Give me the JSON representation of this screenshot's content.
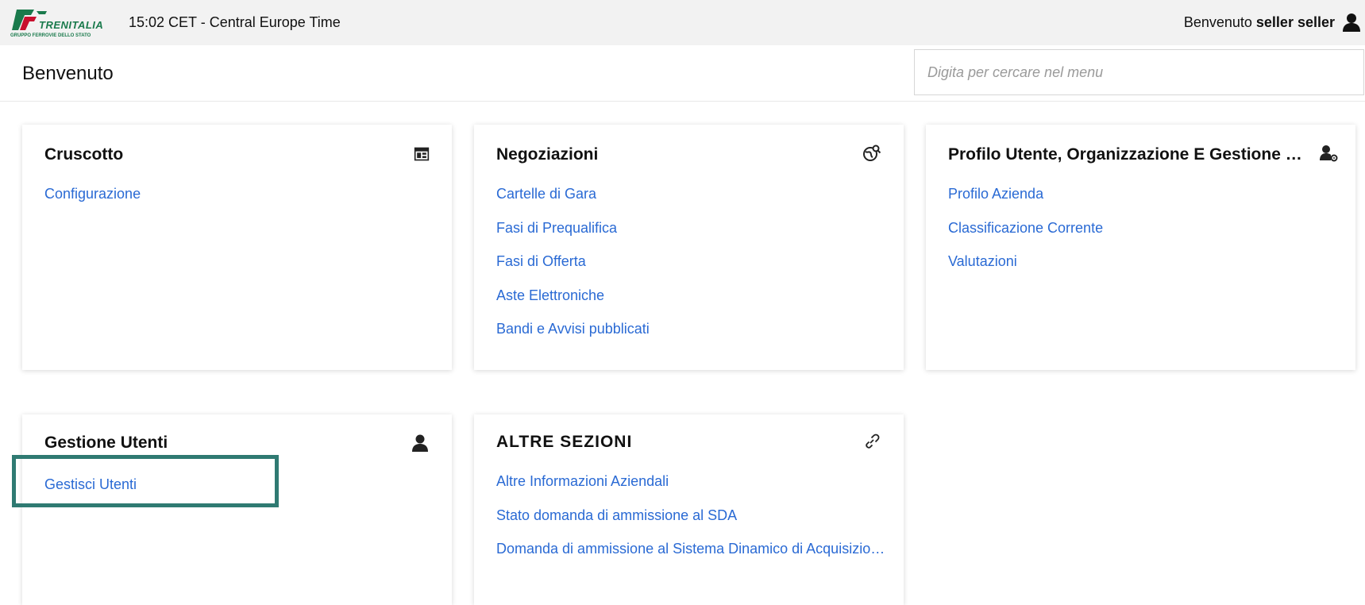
{
  "header": {
    "logo_text": "TRENITALIA",
    "logo_subtext": "GRUPPO FERROVIE DELLO STATO",
    "clock": "15:02 CET - Central Europe Time",
    "welcome_label": "Benvenuto",
    "user_name": "seller seller"
  },
  "subheader": {
    "title": "Benvenuto",
    "search_placeholder": "Digita per cercare nel menu"
  },
  "cards": [
    {
      "title": "Cruscotto",
      "icon": "dashboard-icon",
      "links": [
        "Configurazione"
      ]
    },
    {
      "title": "Negoziazioni",
      "icon": "globe-search-icon",
      "links": [
        "Cartelle di Gara",
        "Fasi di Prequalifica",
        "Fasi di Offerta",
        "Aste Elettroniche",
        "Bandi e Avvisi pubblicati"
      ]
    },
    {
      "title": "Profilo Utente, Organizzazione E Gestione Utenti",
      "icon": "user-settings-icon",
      "links": [
        "Profilo Azienda",
        "Classificazione Corrente",
        "Valutazioni"
      ]
    },
    {
      "title": "Gestione Utenti",
      "icon": "user-icon",
      "links": [
        "Gestisci Utenti"
      ]
    },
    {
      "title": "ALTRE SEZIONI",
      "icon": "link-icon",
      "links": [
        "Altre Informazioni Aziendali",
        "Stato domanda di ammissione al SDA",
        "Domanda di ammissione al Sistema Dinamico di Acquisizione"
      ]
    }
  ],
  "colors": {
    "link": "#2a6ad4",
    "highlight": "#2f7a72",
    "topbar": "#f2f2f2",
    "logo_green": "#1a7a4c",
    "logo_red": "#c8102e"
  }
}
